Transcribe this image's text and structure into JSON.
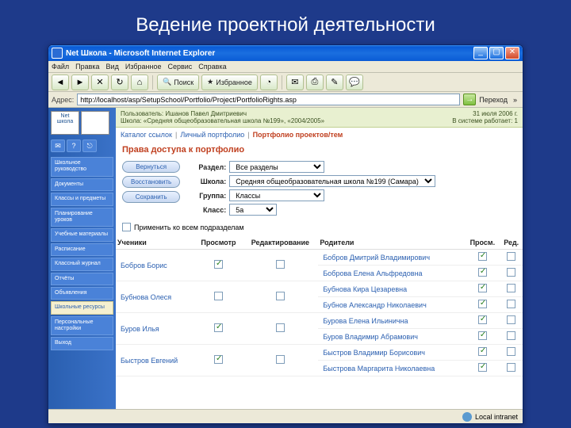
{
  "slide_title": "Ведение проектной деятельности",
  "window": {
    "title": "Net Школа - Microsoft Internet Explorer",
    "min": "_",
    "max": "▢",
    "close": "✕"
  },
  "menubar": [
    "Файл",
    "Правка",
    "Вид",
    "Избранное",
    "Сервис",
    "Справка"
  ],
  "toolbar": {
    "back": "◄",
    "fwd": "►",
    "stop": "✕",
    "refresh": "↻",
    "home": "⌂",
    "search": "🔍",
    "search_lbl": "Поиск",
    "fav": "★",
    "fav_lbl": "Избранное",
    "hist": "◔",
    "mail": "✉",
    "print": "⎙",
    "edit": "✎",
    "msg": "💬"
  },
  "addr": {
    "label": "Адрес:",
    "url": "http://localhost/asp/SetupSchool/Portfolio/Project/PortfolioRights.asp",
    "go": "→",
    "go_lbl": "Переход",
    "links": "»"
  },
  "sidebar": {
    "logo1": "Net школа",
    "logo2": "",
    "icons": [
      "✉",
      "?",
      "⎋"
    ],
    "items": [
      "Школьное руководство",
      "Документы",
      "Классы и предметы",
      "Планирование уроков",
      "Учебные материалы",
      "Расписание",
      "Классный журнал",
      "Отчёты",
      "Объявления",
      "Школьные ресурсы",
      "Персональные настройки",
      "Выход"
    ],
    "active_index": 9
  },
  "userband": {
    "left1": "Пользователь: Ишанов Павел Дмитриевич",
    "left2": "Школа: «Средняя общеобразовательная школа №199», «2004/2005»",
    "right1": "31 июля 2006 г.",
    "right2": "В системе работает: 1"
  },
  "crumbs": {
    "a": "Каталог ссылок",
    "b": "Личный портфолио",
    "c": "Портфолио проектов/тем"
  },
  "page_heading": "Права доступа к портфолио",
  "buttons": {
    "back": "Вернуться",
    "restore": "Восстановить",
    "save": "Сохранить"
  },
  "fields": {
    "section_lbl": "Раздел:",
    "section_val": "Все разделы",
    "school_lbl": "Школа:",
    "school_val": "Средняя общеобразовательная школа №199 (Самара)",
    "group_lbl": "Группа:",
    "group_val": "Классы",
    "class_lbl": "Класс:",
    "class_val": "5а"
  },
  "chk_label": "Применить ко всем подразделам",
  "table": {
    "head": {
      "students": "Ученики",
      "view": "Просмотр",
      "edit": "Редактирование",
      "parents": "Родители",
      "pview": "Просм.",
      "pedit": "Ред."
    },
    "students": [
      "Бобров Борис",
      "Бубнова Олеся",
      "Буров Илья",
      "Быстров Евгений"
    ],
    "parents": [
      "Бобров Дмитрий Владимирович",
      "Боброва Елена Альфредовна",
      "Бубнова Кира Цезаревна",
      "Бубнов Александр Николаевич",
      "Бурова Елена Ильинична",
      "Буров Владимир Абрамович",
      "Быстров Владимир Борисович",
      "Быстрова Маргарита Николаевна"
    ]
  },
  "statusbar": {
    "zone": "Local intranet"
  }
}
